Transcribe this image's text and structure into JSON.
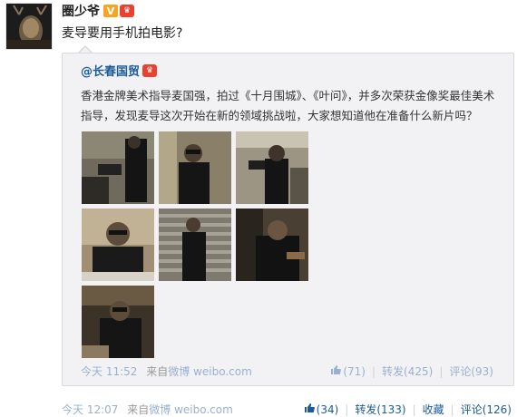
{
  "post": {
    "author": "圈少爷",
    "verified_badge": "V",
    "text": "麦导要用手机拍电影?",
    "time": "今天 12:07",
    "source_prefix": "来自",
    "source": "微博 weibo.com",
    "actions": {
      "like_count": "(34)",
      "repost": "转发(133)",
      "favorite": "收藏",
      "comment": "评论(126)"
    }
  },
  "repost": {
    "author": "@长春国贸",
    "text": "香港金牌美术指导麦国强，拍过《十月围城》、《叶问》，并多次荣获金像奖最佳美术指导，发现麦导这次开始在新的领域挑战啦，大家想知道他在准备什么新片吗？",
    "time": "今天 11:52",
    "source_prefix": "来自",
    "source": "微博 weibo.com",
    "actions": {
      "like_count": "(71)",
      "repost": "转发(425)",
      "comment": "评论(93)"
    },
    "photo_count": 7
  },
  "icons": [
    "avatar-image",
    "verified-v-icon",
    "member-badge-icon",
    "thumbs-up-icon"
  ],
  "colors": {
    "link": "#1b5b98",
    "muted_link": "#9ab0d0",
    "repost_bg": "#f2f2f5",
    "verified": "#f5a623",
    "badge": "#e8412f"
  }
}
